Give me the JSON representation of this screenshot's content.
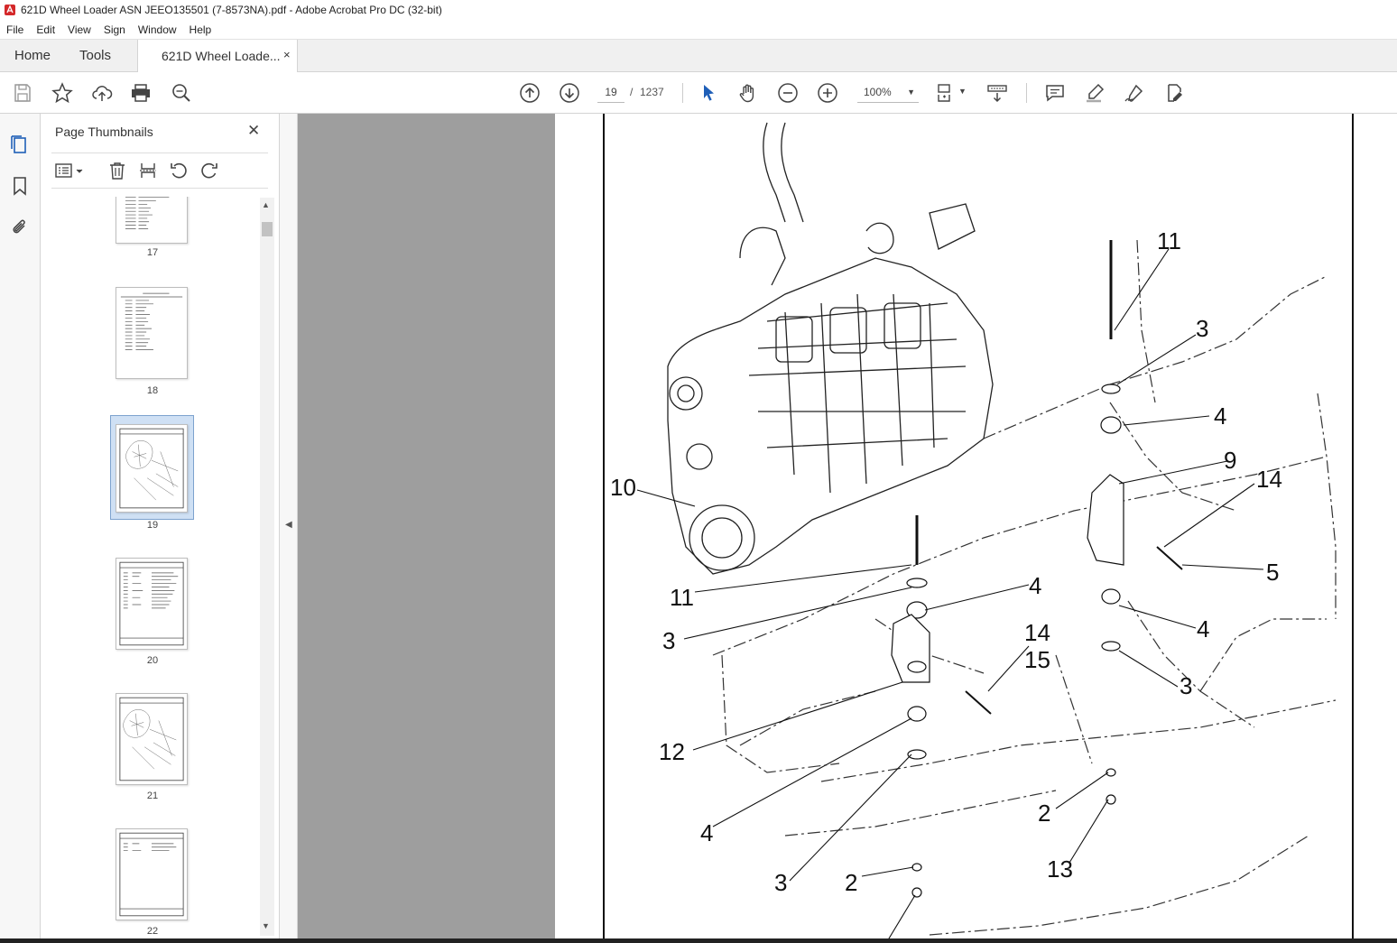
{
  "window": {
    "title": "621D Wheel Loader ASN JEEO135501 (7-8573NA).pdf - Adobe Acrobat Pro DC (32-bit)"
  },
  "menu": [
    "File",
    "Edit",
    "View",
    "Sign",
    "Window",
    "Help"
  ],
  "tabs": {
    "home": "Home",
    "tools": "Tools",
    "document": "621D Wheel Loade...",
    "close_glyph": "×"
  },
  "toolbar": {
    "current_page": "19",
    "page_separator": "/",
    "total_pages": "1237",
    "zoom": "100%"
  },
  "panel": {
    "title": "Page Thumbnails",
    "close_glyph": "✕",
    "thumbnails": [
      {
        "page": "17"
      },
      {
        "page": "18"
      },
      {
        "page": "19",
        "selected": true
      },
      {
        "page": "20"
      },
      {
        "page": "21"
      },
      {
        "page": "22"
      }
    ]
  },
  "drawing": {
    "callouts": [
      "11",
      "3",
      "4",
      "9",
      "14",
      "5",
      "4",
      "3",
      "10",
      "11",
      "3",
      "4",
      "14",
      "15",
      "12",
      "4",
      "3",
      "2",
      "2",
      "13"
    ]
  }
}
